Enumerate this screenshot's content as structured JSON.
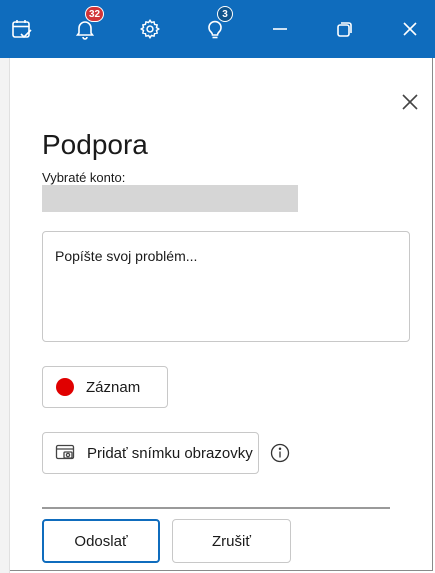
{
  "titlebar": {
    "tasks_icon": "calendar-check-icon",
    "notifications_count": "32",
    "settings_icon": "gear-icon",
    "tips_count": "3",
    "minimize_icon": "minimize-icon",
    "restore_icon": "restore-icon",
    "close_icon": "close-icon"
  },
  "panel": {
    "title": "Podpora",
    "account_label": "Vybraté konto:",
    "problem_placeholder": "Popíšte svoj problém...",
    "record_label": "Záznam",
    "screenshot_label": "Pridať snímku obrazovky",
    "send_label": "Odoslať",
    "cancel_label": "Zrušiť"
  },
  "colors": {
    "titlebar": "#0f6cbd",
    "badge_red": "#d13438",
    "badge_blue": "#0f548c",
    "record_dot": "#e00000"
  }
}
